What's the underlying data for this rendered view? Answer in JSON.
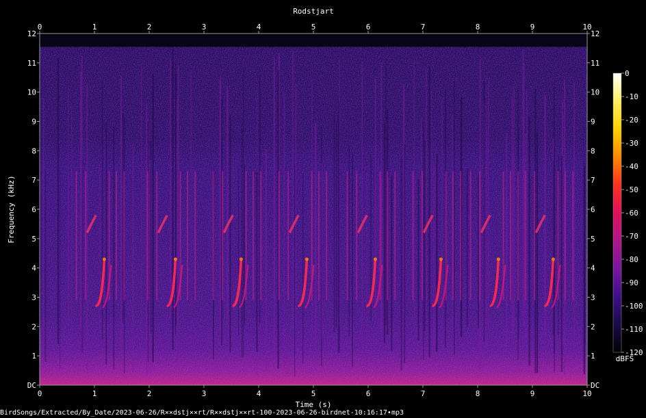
{
  "chart_data": {
    "type": "heatmap",
    "title": "Rodstjart",
    "xlabel": "Time (s)",
    "ylabel": "Frequency (kHz)",
    "x_ticks": [
      "0",
      "1",
      "2",
      "3",
      "4",
      "5",
      "6",
      "7",
      "8",
      "9",
      "10"
    ],
    "y_ticks": [
      "DC",
      "1",
      "2",
      "3",
      "4",
      "5",
      "6",
      "7",
      "8",
      "9",
      "10",
      "11",
      "12"
    ],
    "xlim": [
      0,
      10
    ],
    "ylim": [
      0,
      12
    ],
    "colorbar": {
      "label": "dBFS",
      "ticks": [
        "0",
        "-10",
        "-20",
        "-30",
        "-40",
        "-50",
        "-60",
        "-70",
        "-80",
        "-90",
        "-100",
        "-110",
        "-120"
      ],
      "range": [
        -120,
        0
      ],
      "colors": [
        "#000000",
        "#1a0b48",
        "#3c0f8a",
        "#7a14a0",
        "#b0158c",
        "#e0105a",
        "#ff3020",
        "#ff8a00",
        "#ffd000",
        "#fff060",
        "#ffffff"
      ]
    },
    "song_phrases_start_s": [
      1.02,
      2.32,
      3.52,
      4.72,
      5.97,
      7.17,
      8.22,
      9.22
    ],
    "phrase_sweep_khz": [
      2.7,
      4.3
    ],
    "phrase_upper_note_khz": 5.4,
    "background_dbfs": -100
  },
  "footer_path": "BirdSongs/Extracted/By_Date/2023-06-26/R××dstj××rt/R××dstj××rt-100-2023-06-26-birdnet-10:16:17•mp3"
}
